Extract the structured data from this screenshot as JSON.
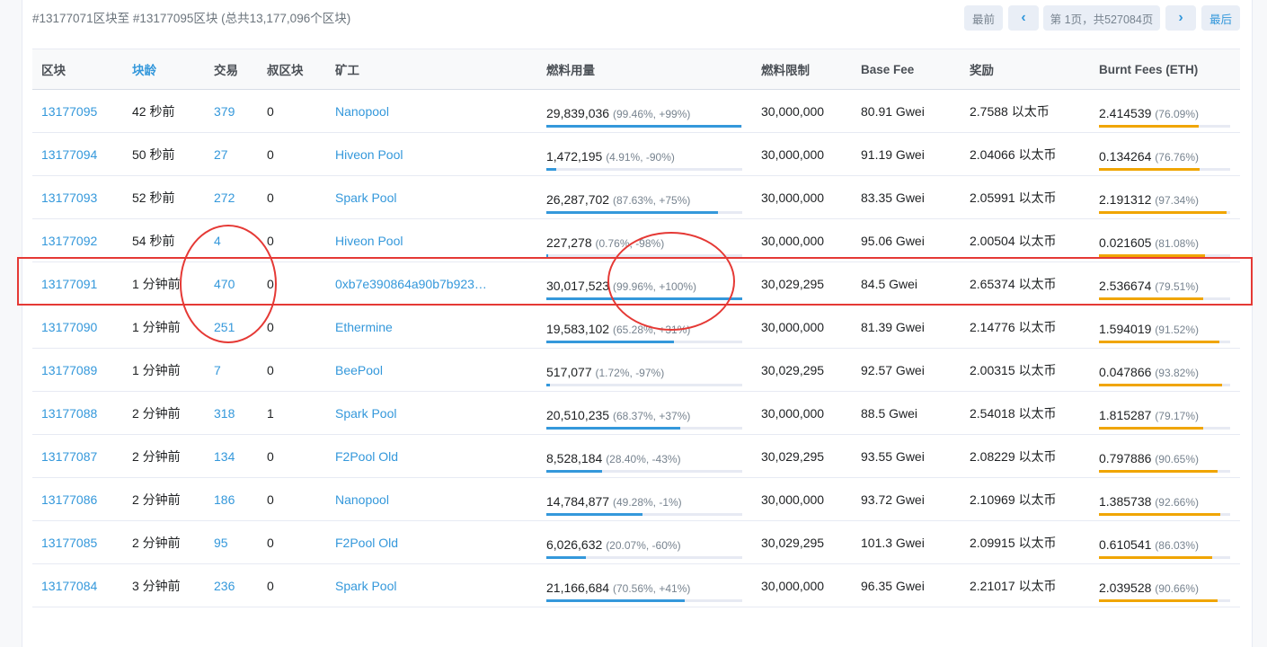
{
  "summary": "#13177071区块至 #13177095区块 (总共13,177,096个区块)",
  "pagination": {
    "first": "最前",
    "prev_icon": "chevron-left-icon",
    "current": "第 1页，共527084页",
    "next_icon": "chevron-right-icon",
    "last": "最后"
  },
  "columns": {
    "block": "区块",
    "age": "块龄",
    "txn": "交易",
    "uncles": "叔区块",
    "miner": "矿工",
    "gas_used": "燃料用量",
    "gas_limit": "燃料限制",
    "base_fee": "Base Fee",
    "reward": "奖励",
    "burnt": "Burnt Fees (ETH)"
  },
  "colors": {
    "link": "#3498db",
    "gas_bar": "#3498db",
    "burnt_bar": "#f0a500",
    "annotation": "#e53935"
  },
  "rows": [
    {
      "block": "13177095",
      "age": "42 秒前",
      "txn": "379",
      "uncles": "0",
      "miner": "Nanopool",
      "gas": "29,839,036",
      "gas_pct": "(99.46%, +99%)",
      "gas_fill": 0.9946,
      "limit": "30,000,000",
      "base_fee": "80.91 Gwei",
      "reward": "2.7588 以太币",
      "burnt": "2.414539",
      "burnt_pct": "(76.09%)",
      "burnt_fill": 0.7609
    },
    {
      "block": "13177094",
      "age": "50 秒前",
      "txn": "27",
      "uncles": "0",
      "miner": "Hiveon Pool",
      "gas": "1,472,195",
      "gas_pct": "(4.91%, -90%)",
      "gas_fill": 0.0491,
      "limit": "30,000,000",
      "base_fee": "91.19 Gwei",
      "reward": "2.04066 以太币",
      "burnt": "0.134264",
      "burnt_pct": "(76.76%)",
      "burnt_fill": 0.7676
    },
    {
      "block": "13177093",
      "age": "52 秒前",
      "txn": "272",
      "uncles": "0",
      "miner": "Spark Pool",
      "gas": "26,287,702",
      "gas_pct": "(87.63%, +75%)",
      "gas_fill": 0.8763,
      "limit": "30,000,000",
      "base_fee": "83.35 Gwei",
      "reward": "2.05991 以太币",
      "burnt": "2.191312",
      "burnt_pct": "(97.34%)",
      "burnt_fill": 0.9734
    },
    {
      "block": "13177092",
      "age": "54 秒前",
      "txn": "4",
      "uncles": "0",
      "miner": "Hiveon Pool",
      "gas": "227,278",
      "gas_pct": "(0.76%, -98%)",
      "gas_fill": 0.0076,
      "limit": "30,000,000",
      "base_fee": "95.06 Gwei",
      "reward": "2.00504 以太币",
      "burnt": "0.021605",
      "burnt_pct": "(81.08%)",
      "burnt_fill": 0.8108
    },
    {
      "block": "13177091",
      "age": "1 分钟前",
      "txn": "470",
      "uncles": "0",
      "miner": "0xb7e390864a90b7b923…",
      "gas": "30,017,523",
      "gas_pct": "(99.96%, +100%)",
      "gas_fill": 0.9996,
      "limit": "30,029,295",
      "base_fee": "84.5 Gwei",
      "reward": "2.65374 以太币",
      "burnt": "2.536674",
      "burnt_pct": "(79.51%)",
      "burnt_fill": 0.7951
    },
    {
      "block": "13177090",
      "age": "1 分钟前",
      "txn": "251",
      "uncles": "0",
      "miner": "Ethermine",
      "gas": "19,583,102",
      "gas_pct": "(65.28%, +31%)",
      "gas_fill": 0.6528,
      "limit": "30,000,000",
      "base_fee": "81.39 Gwei",
      "reward": "2.14776 以太币",
      "burnt": "1.594019",
      "burnt_pct": "(91.52%)",
      "burnt_fill": 0.9152
    },
    {
      "block": "13177089",
      "age": "1 分钟前",
      "txn": "7",
      "uncles": "0",
      "miner": "BeePool",
      "gas": "517,077",
      "gas_pct": "(1.72%, -97%)",
      "gas_fill": 0.0172,
      "limit": "30,029,295",
      "base_fee": "92.57 Gwei",
      "reward": "2.00315 以太币",
      "burnt": "0.047866",
      "burnt_pct": "(93.82%)",
      "burnt_fill": 0.9382
    },
    {
      "block": "13177088",
      "age": "2 分钟前",
      "txn": "318",
      "uncles": "1",
      "miner": "Spark Pool",
      "gas": "20,510,235",
      "gas_pct": "(68.37%, +37%)",
      "gas_fill": 0.6837,
      "limit": "30,000,000",
      "base_fee": "88.5 Gwei",
      "reward": "2.54018 以太币",
      "burnt": "1.815287",
      "burnt_pct": "(79.17%)",
      "burnt_fill": 0.7917
    },
    {
      "block": "13177087",
      "age": "2 分钟前",
      "txn": "134",
      "uncles": "0",
      "miner": "F2Pool Old",
      "gas": "8,528,184",
      "gas_pct": "(28.40%, -43%)",
      "gas_fill": 0.284,
      "limit": "30,029,295",
      "base_fee": "93.55 Gwei",
      "reward": "2.08229 以太币",
      "burnt": "0.797886",
      "burnt_pct": "(90.65%)",
      "burnt_fill": 0.9065
    },
    {
      "block": "13177086",
      "age": "2 分钟前",
      "txn": "186",
      "uncles": "0",
      "miner": "Nanopool",
      "gas": "14,784,877",
      "gas_pct": "(49.28%, -1%)",
      "gas_fill": 0.4928,
      "limit": "30,000,000",
      "base_fee": "93.72 Gwei",
      "reward": "2.10969 以太币",
      "burnt": "1.385738",
      "burnt_pct": "(92.66%)",
      "burnt_fill": 0.9266
    },
    {
      "block": "13177085",
      "age": "2 分钟前",
      "txn": "95",
      "uncles": "0",
      "miner": "F2Pool Old",
      "gas": "6,026,632",
      "gas_pct": "(20.07%, -60%)",
      "gas_fill": 0.2007,
      "limit": "30,029,295",
      "base_fee": "101.3 Gwei",
      "reward": "2.09915 以太币",
      "burnt": "0.610541",
      "burnt_pct": "(86.03%)",
      "burnt_fill": 0.8603
    },
    {
      "block": "13177084",
      "age": "3 分钟前",
      "txn": "236",
      "uncles": "0",
      "miner": "Spark Pool",
      "gas": "21,166,684",
      "gas_pct": "(70.56%, +41%)",
      "gas_fill": 0.7056,
      "limit": "30,000,000",
      "base_fee": "96.35 Gwei",
      "reward": "2.21017 以太币",
      "burnt": "2.039528",
      "burnt_pct": "(90.66%)",
      "burnt_fill": 0.9066
    }
  ]
}
